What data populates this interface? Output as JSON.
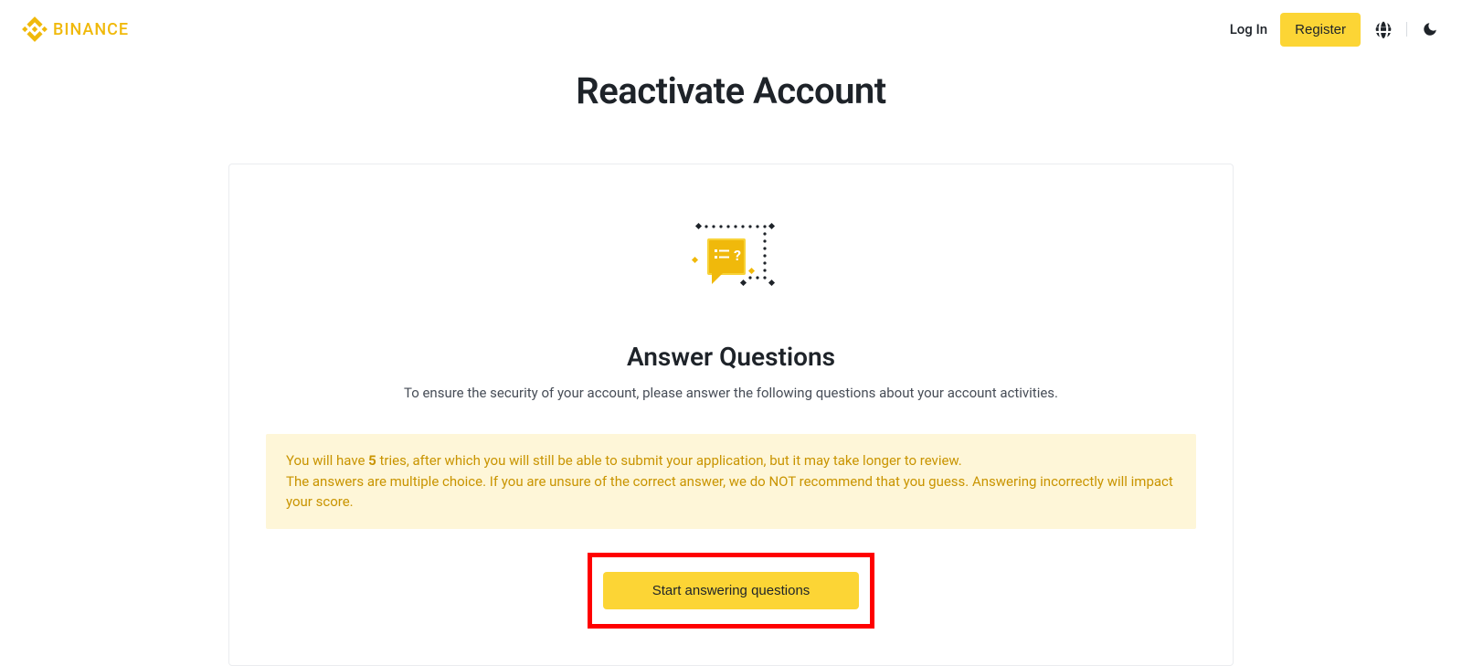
{
  "header": {
    "brand": "BINANCE",
    "login": "Log In",
    "register": "Register"
  },
  "page": {
    "title": "Reactivate Account"
  },
  "card": {
    "heading": "Answer Questions",
    "description": "To ensure the security of your account, please answer the following questions about your account activities.",
    "warning_line1_pre": "You will have ",
    "warning_tries": "5",
    "warning_line1_post": " tries, after which you will still be able to submit your application, but it may take longer to review.",
    "warning_line2": "The answers are multiple choice. If you are unsure of the correct answer, we do NOT recommend that you guess. Answering incorrectly will impact your score.",
    "button": "Start answering questions"
  },
  "colors": {
    "accent": "#fcd535",
    "brand": "#f0b90b",
    "warning_bg": "#fef6d8",
    "warning_text": "#c99400",
    "highlight": "#ff0000"
  }
}
